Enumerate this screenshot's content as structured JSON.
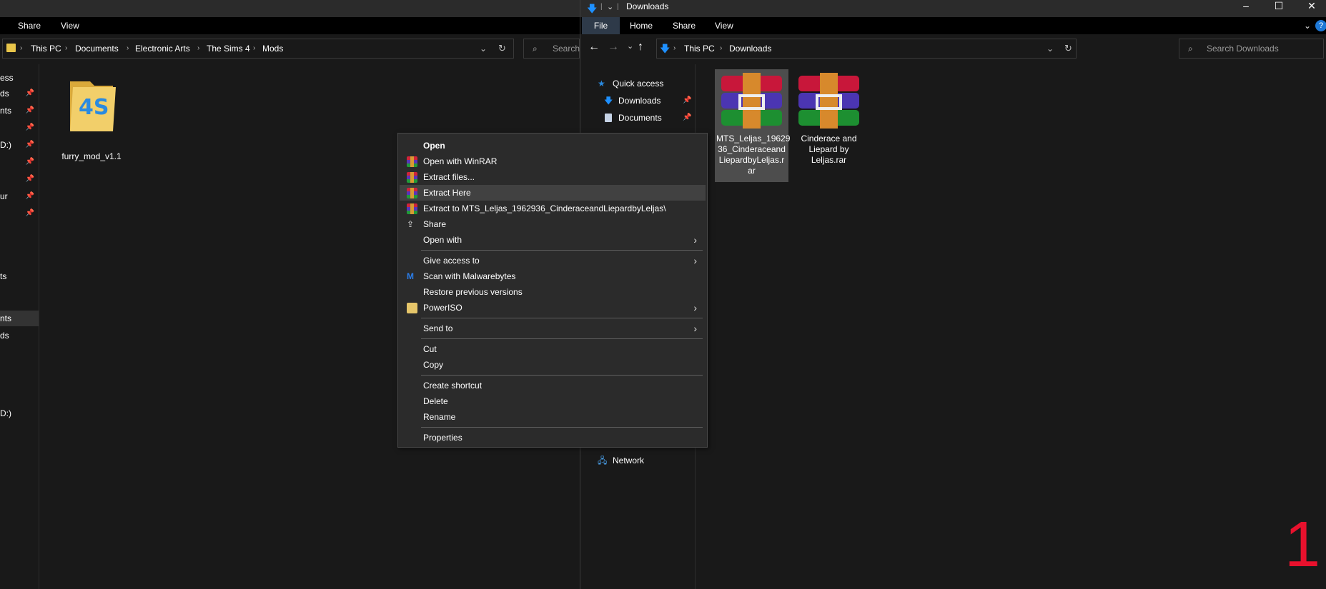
{
  "left_window": {
    "ribbon": [
      "Share",
      "View"
    ],
    "breadcrumb": [
      "This PC",
      "Documents",
      "Electronic Arts",
      "The Sims 4",
      "Mods"
    ],
    "search_placeholder": "Search",
    "nav_items": [
      {
        "label": "ess",
        "pinned": false
      },
      {
        "label": "ds",
        "pinned": true
      },
      {
        "label": "nts",
        "pinned": true
      },
      {
        "label": "",
        "pinned": true
      },
      {
        "label": "D:)",
        "pinned": true
      },
      {
        "label": "",
        "pinned": true
      },
      {
        "label": "",
        "pinned": true
      },
      {
        "label": "ur",
        "pinned": true
      },
      {
        "label": "",
        "pinned": true
      },
      {
        "label": "ts",
        "pinned": false
      },
      {
        "label": "nts",
        "pinned": false
      },
      {
        "label": "ds",
        "pinned": false
      },
      {
        "label": "D:)",
        "pinned": false
      }
    ],
    "files": [
      {
        "name": "furry_mod_v1.1",
        "icon": "folder-icon"
      }
    ]
  },
  "right_window": {
    "title": "Downloads",
    "ribbon": [
      "File",
      "Home",
      "Share",
      "View"
    ],
    "breadcrumb": [
      "This PC",
      "Downloads"
    ],
    "search_placeholder": "Search Downloads",
    "nav_items": [
      {
        "label": "Quick access",
        "icon": "star-icon"
      },
      {
        "label": "Downloads",
        "icon": "download-icon",
        "pinned": true
      },
      {
        "label": "Documents",
        "icon": "document-icon",
        "pinned": true
      },
      {
        "label": "Network",
        "icon": "network-icon"
      }
    ],
    "files": [
      {
        "name": "MTS_Leljas_1962936_CinderaceandLiepardbyLeljas.rar",
        "display": "MTS_Leljas_19629\n36_Cinderaceand\nLiepardbyLeljas.r\nar",
        "selected": true
      },
      {
        "name": "Cinderace and Liepard by Leljas.rar",
        "display": "Cinderace and\nLiepard by\nLeljas.rar",
        "selected": false
      }
    ],
    "window_controls": [
      "–",
      "☐",
      "✕"
    ]
  },
  "context_menu": {
    "items": [
      {
        "label": "Open",
        "bold": true
      },
      {
        "label": "Open with WinRAR",
        "icon": "winrar-icon"
      },
      {
        "label": "Extract files...",
        "icon": "winrar-icon"
      },
      {
        "label": "Extract Here",
        "icon": "winrar-icon",
        "highlighted": true
      },
      {
        "label": "Extract to MTS_Leljas_1962936_CinderaceandLiepardbyLeljas\\",
        "icon": "winrar-icon"
      },
      {
        "label": "Share",
        "icon": "share-icon"
      },
      {
        "label": "Open with",
        "submenu": true
      },
      {
        "label": "Give access to",
        "submenu": true
      },
      {
        "label": "Scan with Malwarebytes",
        "icon": "malwarebytes-icon"
      },
      {
        "label": "Restore previous versions"
      },
      {
        "label": "PowerISO",
        "icon": "poweriso-icon",
        "submenu": true
      },
      {
        "label": "Send to",
        "submenu": true
      },
      {
        "label": "Cut"
      },
      {
        "label": "Copy"
      },
      {
        "label": "Create shortcut"
      },
      {
        "label": "Delete"
      },
      {
        "label": "Rename"
      },
      {
        "label": "Properties"
      }
    ]
  },
  "overlay_number": "1",
  "colors": {
    "background": "#191919",
    "menu_bg": "#2b2b2b",
    "menu_highlight": "#414141",
    "file_tab": "#2e3a49",
    "accent_blue": "#1e90ff",
    "overlay_red": "#e8112d"
  }
}
